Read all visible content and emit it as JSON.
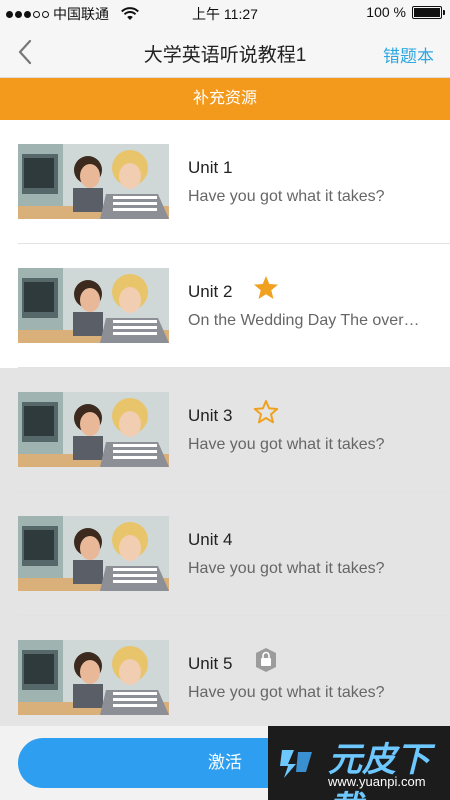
{
  "status_bar": {
    "carrier": "中国联通",
    "time": "上午 11:27",
    "battery": "100 %",
    "battery_level": 1.0
  },
  "nav": {
    "title": "大学英语听说教程1",
    "right_action": "错题本"
  },
  "banner": {
    "label": "补充资源"
  },
  "units": [
    {
      "title": "Unit 1",
      "subtitle": "Have you got what it takes?",
      "badge": "none",
      "state": "active"
    },
    {
      "title": "Unit 2",
      "subtitle": "On the Wedding Day The over…",
      "badge": "star-filled-icon",
      "state": "active"
    },
    {
      "title": "Unit 3",
      "subtitle": "Have you got what it takes?",
      "badge": "star-outline-icon",
      "state": "inactive"
    },
    {
      "title": "Unit 4",
      "subtitle": "Have you got what it takes?",
      "badge": "none",
      "state": "inactive"
    },
    {
      "title": "Unit 5",
      "subtitle": "Have you got what it takes?",
      "badge": "lock-icon",
      "state": "inactive"
    }
  ],
  "bottom": {
    "activate_label": "激活"
  },
  "watermark": {
    "name": "元皮下载",
    "url": "www.yuanpi.com"
  },
  "colors": {
    "accent_orange": "#f39a1c",
    "accent_blue": "#2e9ff0",
    "link_blue": "#2ea8e0",
    "star_gold": "#f0a11f"
  }
}
